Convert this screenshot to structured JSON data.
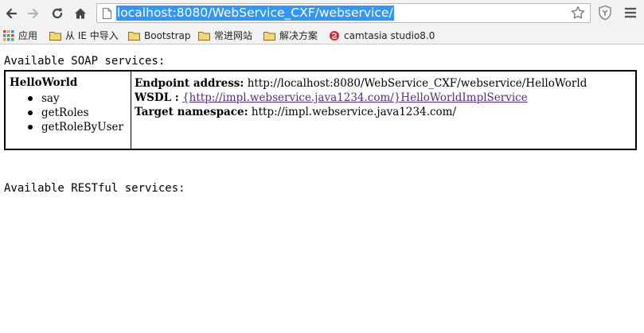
{
  "browser": {
    "url": "localhost:8080/WebService_CXF/webservice/",
    "bookmarks": [
      {
        "label": "应用",
        "icon": "apps-grid-icon"
      },
      {
        "label": "从 IE 中导入",
        "icon": "folder-icon"
      },
      {
        "label": "Bootstrap",
        "icon": "folder-icon"
      },
      {
        "label": "常进网站",
        "icon": "folder-icon"
      },
      {
        "label": "解决方案",
        "icon": "folder-icon"
      },
      {
        "label": "camtasia studio8.0",
        "icon": "site-favicon-icon"
      }
    ]
  },
  "page": {
    "soap_heading": "Available SOAP services:",
    "rest_heading": "Available RESTful services:",
    "service": {
      "name": "HelloWorld",
      "operations": [
        "say",
        "getRoles",
        "getRoleByUser"
      ],
      "endpoint_label": "Endpoint address:",
      "endpoint_value": "http://localhost:8080/WebService_CXF/webservice/HelloWorld",
      "wsdl_label": "WSDL :",
      "wsdl_link": "{http://impl.webservice.java1234.com/}HelloWorldImplService",
      "namespace_label": "Target namespace:",
      "namespace_value": "http://impl.webservice.java1234.com/"
    }
  },
  "colors": {
    "selection": "#3297fd",
    "link_visited": "#5a2a8c",
    "chrome_bg": "#f2f2f2"
  }
}
